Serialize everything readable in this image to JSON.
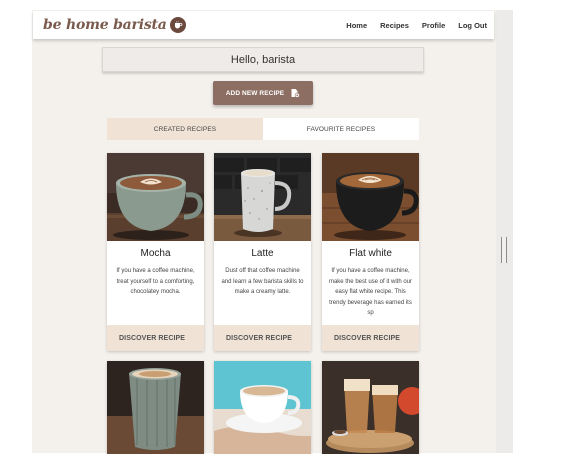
{
  "navbar": {
    "brand": "be home barista",
    "links": [
      "Home",
      "Recipes",
      "Profile",
      "Log Out"
    ]
  },
  "greeting": "Hello, barista",
  "add_button": {
    "label": "ADD NEW RECIPE",
    "icon": "recipe-add-icon"
  },
  "tabs": [
    {
      "label": "CREATED RECIPES",
      "active": true
    },
    {
      "label": "FAVOURITE RECIPES",
      "active": false
    }
  ],
  "recipes": [
    {
      "title": "Mocha",
      "description": "If you have a coffee machine, treat yourself to a comforting, chocolatey mocha.",
      "action": "DISCOVER RECIPE"
    },
    {
      "title": "Latte",
      "description": "Dust off that coffee machine and learn a few barista skills to make a creamy latte.",
      "action": "DISCOVER RECIPE"
    },
    {
      "title": "Flat white",
      "description": "If you have a coffee machine, make the best use of it with our easy flat white recipe. This trendy beverage has earned its sp",
      "action": "DISCOVER RECIPE"
    }
  ],
  "colors": {
    "accent": "#8d6e63",
    "tab_active": "#f0e3d6",
    "page_bg": "#f4f1ed"
  }
}
